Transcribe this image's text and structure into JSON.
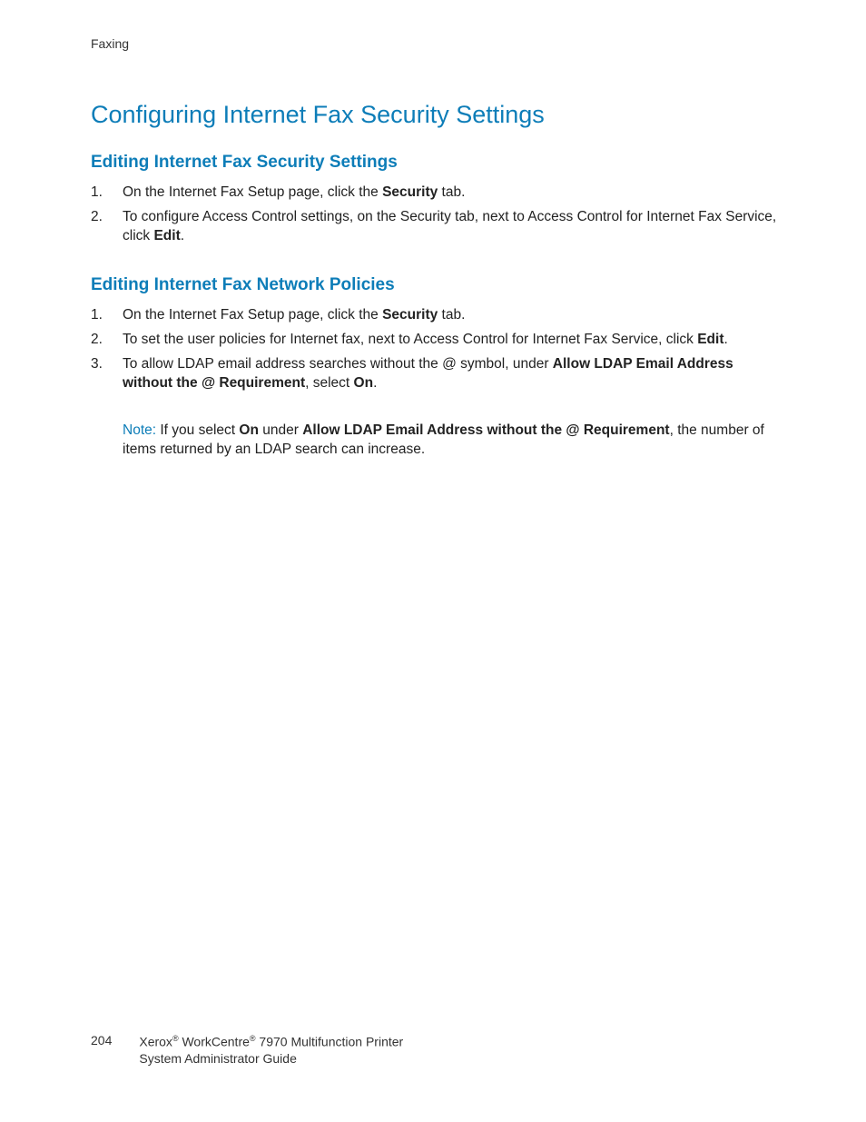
{
  "header": {
    "section": "Faxing"
  },
  "title": "Configuring Internet Fax Security Settings",
  "section1": {
    "heading": "Editing Internet Fax Security Settings",
    "item1_a": "On the Internet Fax Setup page, click the ",
    "item1_b": "Security",
    "item1_c": " tab.",
    "item2_a": "To configure Access Control settings, on the Security tab, next to Access Control for Internet Fax Service, click ",
    "item2_b": "Edit",
    "item2_c": "."
  },
  "section2": {
    "heading": "Editing Internet Fax Network Policies",
    "item1_a": "On the Internet Fax Setup page, click the ",
    "item1_b": "Security",
    "item1_c": " tab.",
    "item2_a": "To set the user policies for Internet fax, next to Access Control for Internet Fax Service, click ",
    "item2_b": "Edit",
    "item2_c": ".",
    "item3_a": "To allow LDAP email address searches without the @ symbol, under ",
    "item3_b": "Allow LDAP Email Address without the @ Requirement",
    "item3_c": ", select ",
    "item3_d": "On",
    "item3_e": ".",
    "note_label": "Note:",
    "note_a": " If you select ",
    "note_b": "On",
    "note_c": " under ",
    "note_d": "Allow LDAP Email Address without the @ Requirement",
    "note_e": ", the number of items returned by an LDAP search can increase."
  },
  "footer": {
    "page": "204",
    "brand1": "Xerox",
    "reg": "®",
    "brand2": " WorkCentre",
    "model": " 7970 Multifunction Printer",
    "line2": "System Administrator Guide"
  }
}
